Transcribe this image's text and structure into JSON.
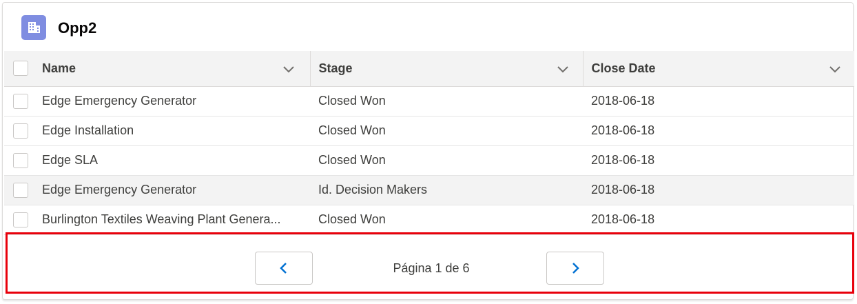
{
  "card": {
    "title": "Opp2",
    "icon": "building-icon"
  },
  "table": {
    "columns": [
      {
        "label": "Name"
      },
      {
        "label": "Stage"
      },
      {
        "label": "Close Date"
      }
    ],
    "rows": [
      {
        "name": "Edge Emergency Generator",
        "stage": "Closed Won",
        "close_date": "2018-06-18"
      },
      {
        "name": "Edge Installation",
        "stage": "Closed Won",
        "close_date": "2018-06-18"
      },
      {
        "name": "Edge SLA",
        "stage": "Closed Won",
        "close_date": "2018-06-18"
      },
      {
        "name": "Edge Emergency Generator",
        "stage": "Id. Decision Makers",
        "close_date": "2018-06-18"
      },
      {
        "name": "Burlington Textiles Weaving Plant Genera...",
        "stage": "Closed Won",
        "close_date": "2018-06-18"
      }
    ]
  },
  "pagination": {
    "label": "Página 1 de 6",
    "prev_icon": "chevron-left-icon",
    "next_icon": "chevron-right-icon"
  },
  "colors": {
    "icon_bg": "#7f8de1",
    "brand_blue": "#0070d2",
    "highlight_border": "#e8000b",
    "header_bg": "#f3f3f3"
  }
}
